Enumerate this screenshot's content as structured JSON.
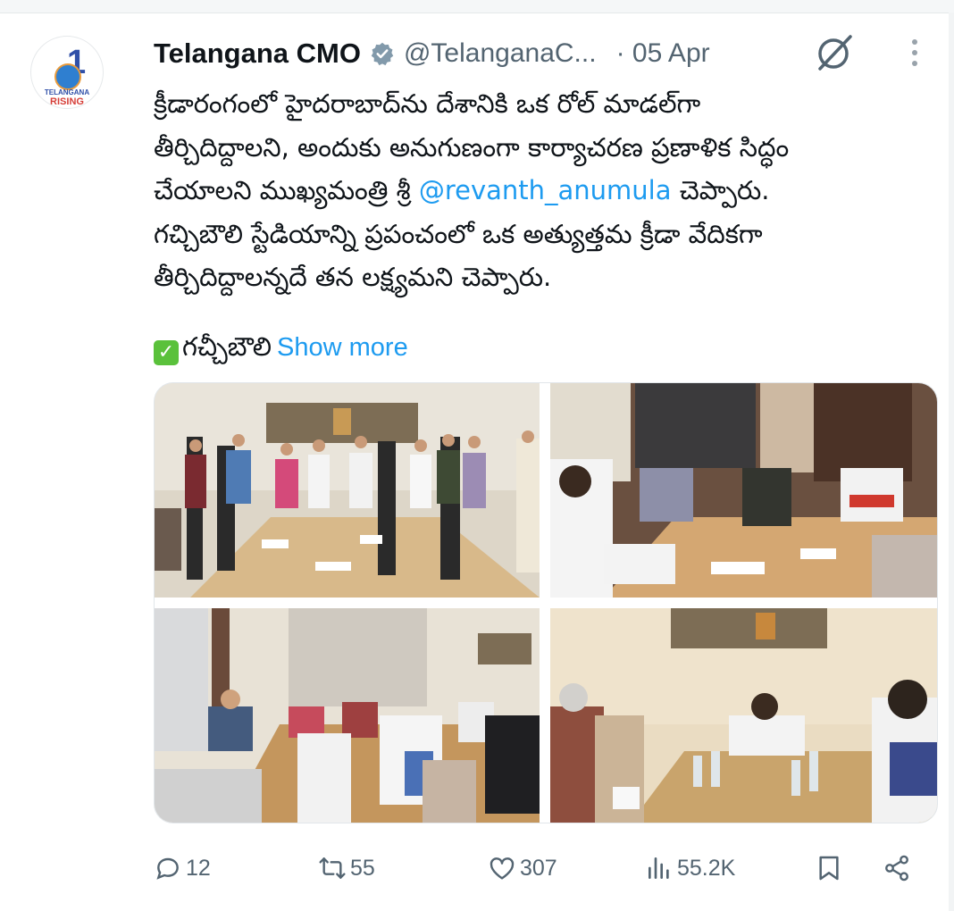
{
  "account": {
    "name": "Telangana CMO",
    "handle": "@TelanganaC...",
    "date": "· 05 Apr",
    "avatar_number": "1",
    "avatar_line1": "TELANGANA",
    "avatar_line2": "RISING"
  },
  "tweet": {
    "line1": "క్రీడారంగంలో హైదరాబాద్‌ను దేశానికి ఒక రోల్ మాడల్‌గా",
    "line2": "తీర్చిదిద్దాలని, అందుకు అనుగుణంగా కార్యాచరణ ప్రణాళిక సిద్ధం",
    "line3_a": "చేయాలని ముఖ్యమంత్రి శ్రీ ",
    "mention": "@revanth_anumula",
    "line3_b": " చెప్పారు.",
    "line4": "గచ్చిబౌలి స్టేడియాన్ని ప్రపంచంలో ఒక అత్యుత్తమ క్రీడా వేదికగా",
    "line5": "తీర్చిదిద్దాలన్నదే తన లక్ష్యమని చెప్పారు.",
    "extra_check": "✓",
    "extra": "గచ్చీబౌలి",
    "show_more": "Show more"
  },
  "actions": {
    "replies": "12",
    "reposts": "55",
    "likes": "307",
    "views": "55.2K"
  },
  "colors": {
    "link": "#1d9bf0",
    "muted": "#536471",
    "verified": "#829aab"
  },
  "icons": [
    "verified-badge-icon",
    "grok-icon",
    "more-options-icon",
    "reply-icon",
    "repost-icon",
    "like-icon",
    "views-icon",
    "bookmark-icon",
    "share-icon"
  ]
}
